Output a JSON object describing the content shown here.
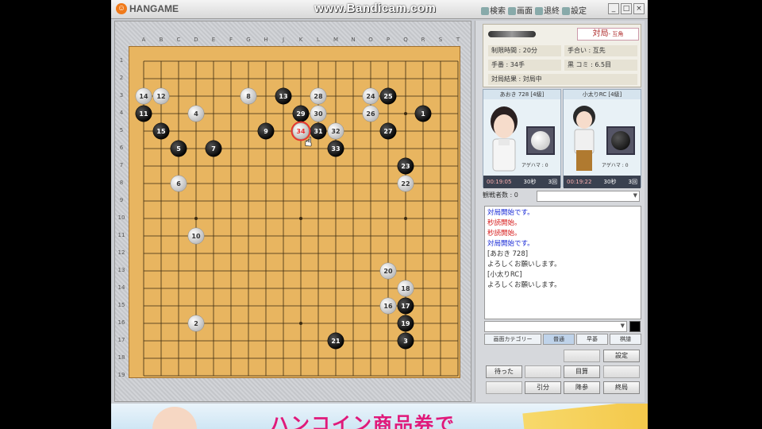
{
  "window": {
    "logo": "HANGAME",
    "watermark": "www.Bandicam.com",
    "menu": [
      "検索",
      "画面",
      "退終",
      "設定"
    ]
  },
  "board": {
    "size": 19,
    "columns": [
      "A",
      "B",
      "C",
      "D",
      "E",
      "F",
      "G",
      "H",
      "J",
      "K",
      "L",
      "M",
      "N",
      "O",
      "P",
      "Q",
      "R",
      "S",
      "T"
    ],
    "rows": [
      "1",
      "2",
      "3",
      "4",
      "5",
      "6",
      "7",
      "8",
      "9",
      "10",
      "11",
      "12",
      "13",
      "14",
      "15",
      "16",
      "17",
      "18",
      "19"
    ],
    "star_points": [
      [
        4,
        4
      ],
      [
        10,
        4
      ],
      [
        16,
        4
      ],
      [
        4,
        10
      ],
      [
        10,
        10
      ],
      [
        16,
        10
      ],
      [
        4,
        16
      ],
      [
        10,
        16
      ],
      [
        16,
        16
      ]
    ],
    "last_move": 34,
    "stones": [
      {
        "n": 1,
        "c": 17,
        "r": 4,
        "color": "black"
      },
      {
        "n": 2,
        "c": 4,
        "r": 16,
        "color": "white"
      },
      {
        "n": 3,
        "c": 16,
        "r": 17,
        "color": "black"
      },
      {
        "n": 4,
        "c": 4,
        "r": 4,
        "color": "white"
      },
      {
        "n": 5,
        "c": 3,
        "r": 6,
        "color": "black"
      },
      {
        "n": 6,
        "c": 3,
        "r": 8,
        "color": "white"
      },
      {
        "n": 7,
        "c": 5,
        "r": 6,
        "color": "black"
      },
      {
        "n": 8,
        "c": 7,
        "r": 3,
        "color": "white"
      },
      {
        "n": 9,
        "c": 8,
        "r": 5,
        "color": "black"
      },
      {
        "n": 10,
        "c": 4,
        "r": 11,
        "color": "white"
      },
      {
        "n": 11,
        "c": 1,
        "r": 4,
        "color": "black"
      },
      {
        "n": 12,
        "c": 2,
        "r": 3,
        "color": "white"
      },
      {
        "n": 13,
        "c": 9,
        "r": 3,
        "color": "black"
      },
      {
        "n": 14,
        "c": 1,
        "r": 3,
        "color": "white"
      },
      {
        "n": 15,
        "c": 2,
        "r": 5,
        "color": "black"
      },
      {
        "n": 16,
        "c": 15,
        "r": 15,
        "color": "white"
      },
      {
        "n": 17,
        "c": 16,
        "r": 15,
        "color": "black"
      },
      {
        "n": 18,
        "c": 16,
        "r": 14,
        "color": "white"
      },
      {
        "n": 19,
        "c": 16,
        "r": 16,
        "color": "black"
      },
      {
        "n": 20,
        "c": 15,
        "r": 13,
        "color": "white"
      },
      {
        "n": 21,
        "c": 12,
        "r": 17,
        "color": "black"
      },
      {
        "n": 22,
        "c": 16,
        "r": 8,
        "color": "white"
      },
      {
        "n": 23,
        "c": 16,
        "r": 7,
        "color": "black"
      },
      {
        "n": 24,
        "c": 14,
        "r": 3,
        "color": "white"
      },
      {
        "n": 25,
        "c": 15,
        "r": 3,
        "color": "black"
      },
      {
        "n": 26,
        "c": 14,
        "r": 4,
        "color": "white"
      },
      {
        "n": 27,
        "c": 15,
        "r": 5,
        "color": "black"
      },
      {
        "n": 28,
        "c": 11,
        "r": 3,
        "color": "white"
      },
      {
        "n": 29,
        "c": 10,
        "r": 4,
        "color": "black"
      },
      {
        "n": 30,
        "c": 11,
        "r": 4,
        "color": "white"
      },
      {
        "n": 31,
        "c": 11,
        "r": 5,
        "color": "black"
      },
      {
        "n": 32,
        "c": 12,
        "r": 5,
        "color": "white"
      },
      {
        "n": 33,
        "c": 12,
        "r": 6,
        "color": "black"
      },
      {
        "n": 34,
        "c": 10,
        "r": 5,
        "color": "white"
      }
    ]
  },
  "game_info": {
    "title": "対局",
    "title_sub": "- 互角",
    "time_limit": "制限時間 : 20分",
    "handicap": "手合い : 互先",
    "moves": "手番 : 34手",
    "komi": "黒 コミ : 6.5目",
    "result": "対局結果 : 対局中"
  },
  "players": [
    {
      "name": "あおき 728 [4級]",
      "caps": "アゲハマ : 0",
      "time": "00:19:05",
      "byoyomi": "30秒",
      "periods": "3回",
      "stone": "white"
    },
    {
      "name": "小太りRC [4級]",
      "caps": "アゲハマ : 0",
      "time": "00:19:22",
      "byoyomi": "30秒",
      "periods": "3回",
      "stone": "black"
    }
  ],
  "watch_label": "観戦者数 : 0",
  "chat": [
    {
      "text": "対局開始です。",
      "color": "#1a2bd6"
    },
    {
      "text": "秒読開始。",
      "color": "#d61a1a"
    },
    {
      "text": "秒読開始。",
      "color": "#d61a1a"
    },
    {
      "text": "対局開始です。",
      "color": "#1a2bd6"
    },
    {
      "text": "[あおき 728]",
      "color": "#333333"
    },
    {
      "text": "よろしくお願いします。",
      "color": "#333333"
    },
    {
      "text": "[小太りRC]",
      "color": "#333333"
    },
    {
      "text": "よろしくお願いします。",
      "color": "#333333"
    }
  ],
  "tabs": [
    "画面カテゴリー",
    "普通",
    "早碁",
    "棋譜"
  ],
  "buttons": {
    "row1": [
      "",
      "",
      "設定"
    ],
    "row2": [
      "待った",
      "",
      "目算",
      ""
    ],
    "row3": [
      "",
      "引分",
      "降参",
      "終局"
    ]
  },
  "banner": {
    "text": "ハンコイン商品券で"
  }
}
